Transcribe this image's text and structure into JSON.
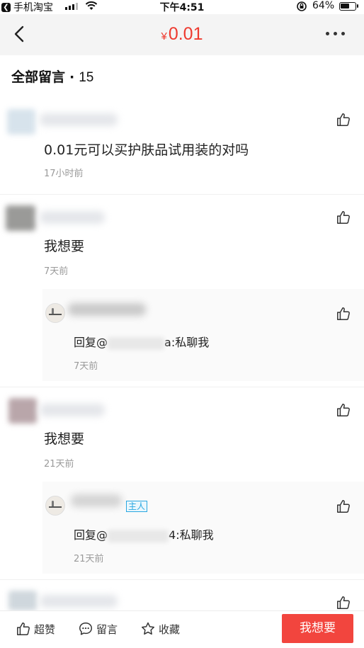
{
  "status_bar": {
    "back_app_label": "手机淘宝",
    "time": "下午4:51",
    "battery_pct": "64%",
    "battery_level": 0.64
  },
  "nav": {
    "currency": "¥",
    "price": "0.01",
    "back_icon": "chevron-left-icon",
    "more_icon": "more-dots-icon"
  },
  "section": {
    "title": "全部留言",
    "separator": "·",
    "count": "15"
  },
  "comments": [
    {
      "text": "0.01元可以买护肤品试用装的对吗",
      "time": "17小时前"
    },
    {
      "text": "我想要",
      "time": "7天前"
    },
    {
      "text": "我想要",
      "time": "21天前"
    }
  ],
  "replies": [
    {
      "prefix": "回复@",
      "suffix_visible": "a:私聊我",
      "time": "7天前"
    },
    {
      "prefix": "回复@",
      "suffix_visible": "4:私聊我",
      "time": "21天前",
      "badge": "主人"
    }
  ],
  "bottom_bar": {
    "like_label": "超赞",
    "comment_label": "留言",
    "favorite_label": "收藏",
    "want_label": "我想要"
  },
  "colors": {
    "accent_red": "#ee3a2f",
    "button_red": "#f2453e",
    "badge_blue": "#29a7e1",
    "time_gray": "#9a9a9a"
  }
}
